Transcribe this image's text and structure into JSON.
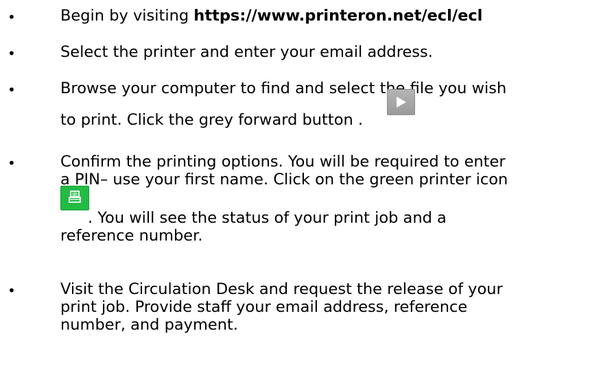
{
  "steps": [
    {
      "prefix": "Begin by visiting ",
      "url": "https://www.printeron.net/ecl/ecl"
    },
    {
      "text": "Select the printer and enter your email address."
    },
    {
      "line1": "Browse your computer to find and select the file you wish",
      "line2": "to print. Click the grey forward button .",
      "icon": "play-forward-icon",
      "icon_color": "#a8a8a8"
    },
    {
      "line1": "Confirm the printing options. You will be required to enter",
      "line2": "a PIN– use your first name. Click on the green printer icon",
      "line3": ". You will see the status of your print job and a",
      "line4": "reference number.",
      "icon": "printer-icon",
      "icon_color": "#22bb44"
    },
    {
      "line1": "Visit the Circulation Desk and request the release of your",
      "line2": "print job. Provide staff your email address, reference",
      "line3": "number, and payment."
    }
  ],
  "bullet_symbol": "•"
}
